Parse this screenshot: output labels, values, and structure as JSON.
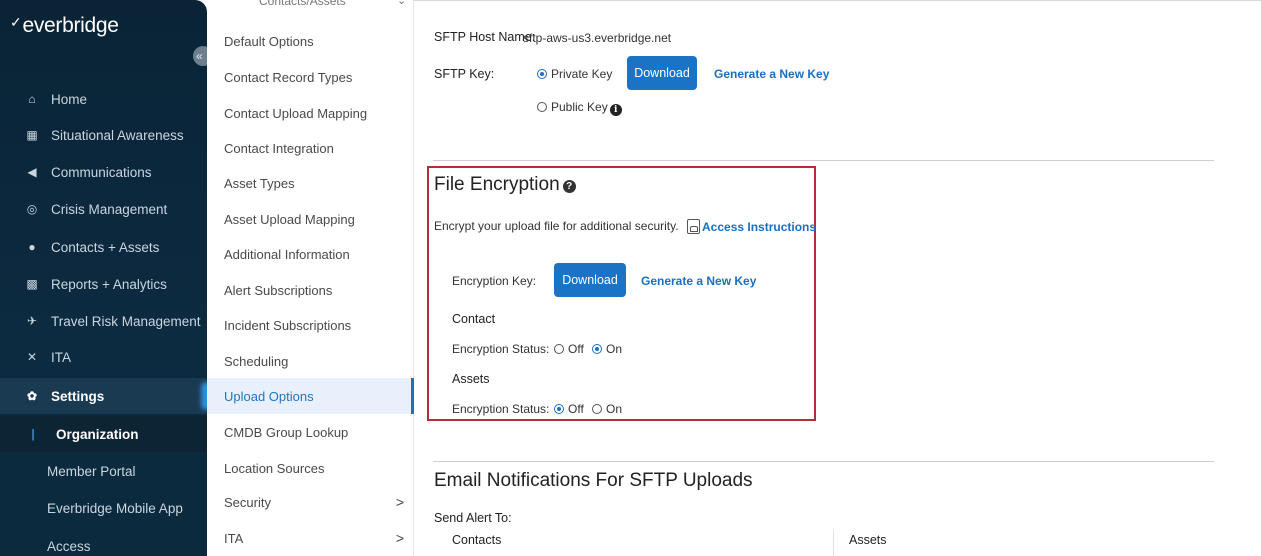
{
  "sidebar": {
    "brand": "everbridge",
    "collapse_glyph": "«",
    "items": [
      {
        "label": "Home",
        "icon": "home-icon",
        "glyph": "⌂"
      },
      {
        "label": "Situational Awareness",
        "icon": "map-icon",
        "glyph": "▦"
      },
      {
        "label": "Communications",
        "icon": "megaphone-icon",
        "glyph": "◀"
      },
      {
        "label": "Crisis Management",
        "icon": "alert-circle-icon",
        "glyph": "◎"
      },
      {
        "label": "Contacts + Assets",
        "icon": "location-pin-icon",
        "glyph": "●"
      },
      {
        "label": "Reports + Analytics",
        "icon": "chart-icon",
        "glyph": "▩"
      },
      {
        "label": "Travel Risk Management",
        "icon": "plane-icon",
        "glyph": "✈"
      },
      {
        "label": "ITA",
        "icon": "ita-icon",
        "glyph": "✕"
      },
      {
        "label": "Settings",
        "icon": "gear-icon",
        "glyph": "✿"
      }
    ],
    "sub_items": [
      {
        "label": "Organization",
        "marker": "|"
      },
      {
        "label": "Member Portal"
      },
      {
        "label": "Everbridge Mobile App"
      },
      {
        "label": "Access"
      }
    ]
  },
  "submenu": {
    "partial_header": "Contacts/Assets",
    "partial_chevron": "⌄",
    "items": [
      "Default Options",
      "Contact Record Types",
      "Contact Upload Mapping",
      "Contact Integration",
      "Asset Types",
      "Asset Upload Mapping",
      "Additional Information",
      "Alert Subscriptions",
      "Incident Subscriptions",
      "Scheduling",
      "Upload Options",
      "CMDB Group Lookup",
      "Location Sources"
    ],
    "sections": [
      {
        "label": "Security",
        "chevron": ">"
      },
      {
        "label": "ITA",
        "chevron": ">"
      }
    ]
  },
  "sftp": {
    "host_label": "SFTP Host Name:",
    "host_value": "sftp-aws-us3.everbridge.net",
    "key_label": "SFTP Key:",
    "private_key": "Private Key",
    "public_key": "Public Key",
    "download": "Download",
    "generate": "Generate a New Key",
    "info_glyph": "i"
  },
  "encryption": {
    "title": "File Encryption",
    "help_glyph": "?",
    "description": "Encrypt your upload file for additional security.",
    "access_link": "Access Instructions",
    "key_label": "Encryption Key:",
    "download": "Download",
    "generate": "Generate a New Key",
    "contact_heading": "Contact",
    "status_label": "Encryption Status:",
    "off": "Off",
    "on": "On",
    "assets_heading": "Assets"
  },
  "email": {
    "title": "Email Notifications For SFTP Uploads",
    "send_alert": "Send Alert To:",
    "col_contacts": "Contacts",
    "col_assets": "Assets"
  }
}
